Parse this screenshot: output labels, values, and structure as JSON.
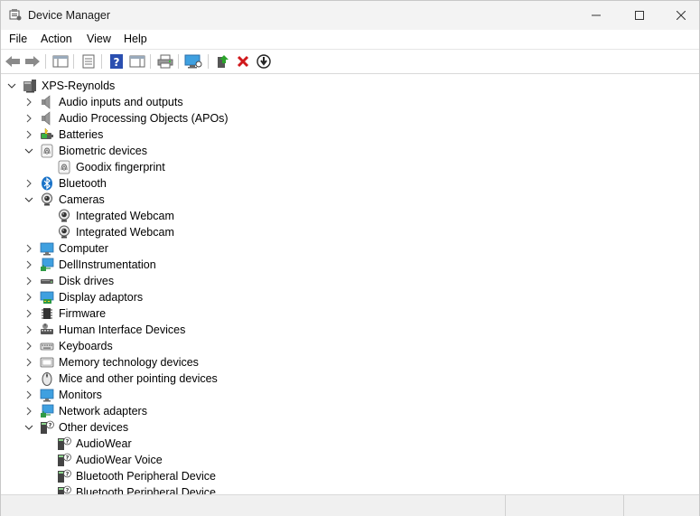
{
  "window": {
    "title": "Device Manager"
  },
  "menu": {
    "items": [
      "File",
      "Action",
      "View",
      "Help"
    ]
  },
  "toolbar": {
    "buttons": [
      "back",
      "forward",
      "show-hide-console-tree",
      "properties",
      "help",
      "action-pane",
      "print",
      "scan-hardware-changes",
      "update-driver",
      "uninstall-device",
      "disable-device"
    ]
  },
  "tree": {
    "root": {
      "label": "XPS-Reynolds",
      "icon": "computer-icon",
      "expanded": true
    },
    "items": [
      {
        "label": "Audio inputs and outputs",
        "icon": "speaker-icon",
        "expanded": false,
        "children": []
      },
      {
        "label": "Audio Processing Objects (APOs)",
        "icon": "speaker-icon",
        "expanded": false,
        "children": []
      },
      {
        "label": "Batteries",
        "icon": "battery-icon",
        "expanded": false,
        "children": []
      },
      {
        "label": "Biometric devices",
        "icon": "fingerprint-icon",
        "expanded": true,
        "children": [
          {
            "label": "Goodix fingerprint",
            "icon": "fingerprint-icon"
          }
        ]
      },
      {
        "label": "Bluetooth",
        "icon": "bluetooth-icon",
        "expanded": false,
        "children": []
      },
      {
        "label": "Cameras",
        "icon": "webcam-icon",
        "expanded": true,
        "children": [
          {
            "label": "Integrated Webcam",
            "icon": "webcam-icon"
          },
          {
            "label": "Integrated Webcam",
            "icon": "webcam-icon"
          }
        ]
      },
      {
        "label": "Computer",
        "icon": "monitor-icon",
        "expanded": false,
        "children": []
      },
      {
        "label": "DellInstrumentation",
        "icon": "network-monitor-icon",
        "expanded": false,
        "children": []
      },
      {
        "label": "Disk drives",
        "icon": "disk-drive-icon",
        "expanded": false,
        "children": []
      },
      {
        "label": "Display adaptors",
        "icon": "display-adapter-icon",
        "expanded": false,
        "children": []
      },
      {
        "label": "Firmware",
        "icon": "chip-icon",
        "expanded": false,
        "children": []
      },
      {
        "label": "Human Interface Devices",
        "icon": "hid-icon",
        "expanded": false,
        "children": []
      },
      {
        "label": "Keyboards",
        "icon": "keyboard-icon",
        "expanded": false,
        "children": []
      },
      {
        "label": "Memory technology devices",
        "icon": "memory-icon",
        "expanded": false,
        "children": []
      },
      {
        "label": "Mice and other pointing devices",
        "icon": "mouse-icon",
        "expanded": false,
        "children": []
      },
      {
        "label": "Monitors",
        "icon": "monitor-icon",
        "expanded": false,
        "children": []
      },
      {
        "label": "Network adapters",
        "icon": "network-monitor-icon",
        "expanded": false,
        "children": []
      },
      {
        "label": "Other devices",
        "icon": "unknown-device-icon",
        "expanded": true,
        "children": [
          {
            "label": "AudioWear",
            "icon": "unknown-device-icon"
          },
          {
            "label": "AudioWear Voice",
            "icon": "unknown-device-icon"
          },
          {
            "label": "Bluetooth Peripheral Device",
            "icon": "unknown-device-icon"
          },
          {
            "label": "Bluetooth Peripheral Device",
            "icon": "unknown-device-icon"
          }
        ]
      }
    ]
  },
  "colors": {
    "titlebar": "#f3f3f3",
    "accent_blue": "#1a73c8",
    "uninstall_red": "#d0181b",
    "statusbar": "#f0f0f0"
  }
}
